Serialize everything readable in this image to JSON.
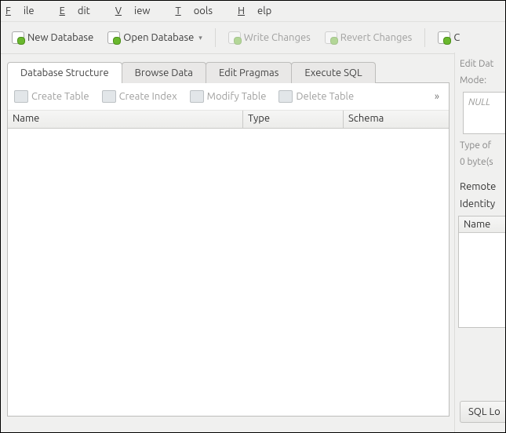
{
  "menu": {
    "file": [
      "F",
      "ile"
    ],
    "edit": [
      "E",
      "dit"
    ],
    "view": [
      "V",
      "iew"
    ],
    "tools": [
      "T",
      "ools"
    ],
    "help": [
      "H",
      "elp"
    ]
  },
  "toolbar": {
    "new_db": "New Database",
    "open_db": "Open Database",
    "write": "Write Changes",
    "revert": "Revert Changes",
    "trunc": "C"
  },
  "tabs": [
    "Database Structure",
    "Browse Data",
    "Edit Pragmas",
    "Execute SQL"
  ],
  "structure_toolbar": {
    "create_table": "Create Table",
    "create_index": "Create Index",
    "modify_table": "Modify Table",
    "delete_table": "Delete Table",
    "overflow": "»"
  },
  "columns": [
    "Name",
    "Type",
    "Schema"
  ],
  "side": {
    "edit_heading": "Edit Dat",
    "mode_label": "Mode:",
    "cell_value": "NULL",
    "type_label": "Type of",
    "size_label": "0 byte(s",
    "remote_heading": "Remote",
    "identity_label": "Identity",
    "name_col": "Name",
    "sql_log": "SQL Lo"
  }
}
